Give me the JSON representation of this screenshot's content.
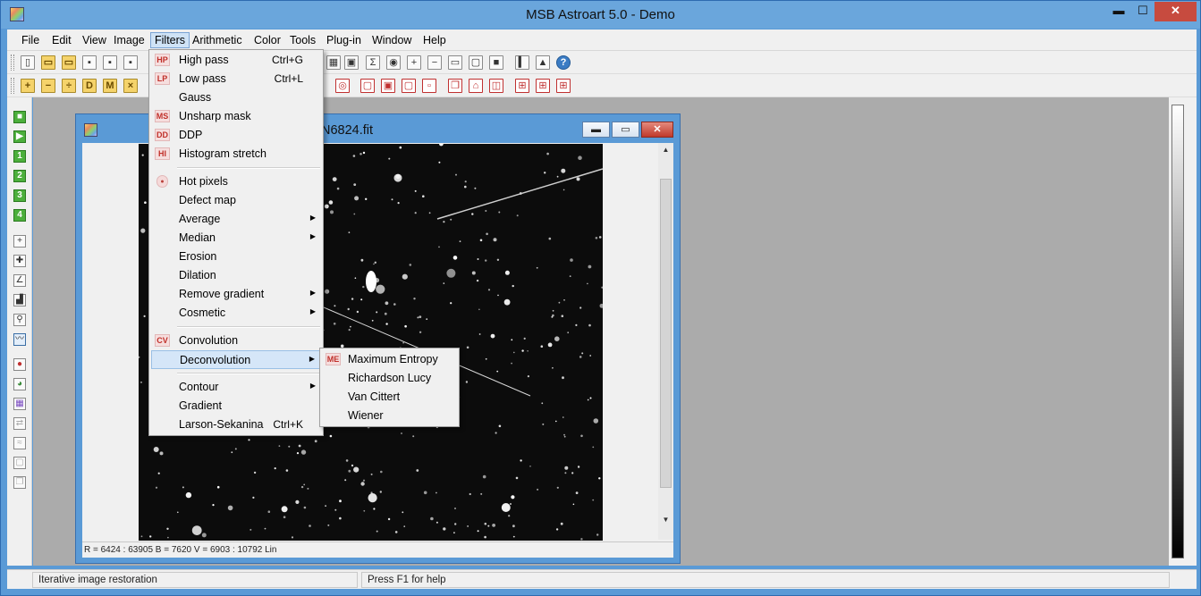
{
  "app": {
    "title": "MSB Astroart 5.0 - Demo",
    "controls": {
      "minimize": "▬",
      "maximize": "☐",
      "close": "✕"
    }
  },
  "menubar": [
    {
      "label": "File"
    },
    {
      "label": "Edit"
    },
    {
      "label": "View"
    },
    {
      "label": "Image"
    },
    {
      "label": "Filters"
    },
    {
      "label": "Arithmetic"
    },
    {
      "label": "Color"
    },
    {
      "label": "Tools"
    },
    {
      "label": "Plug-in"
    },
    {
      "label": "Window"
    },
    {
      "label": "Help"
    }
  ],
  "active_menu": "Filters",
  "toolbar1_icons": [
    "new-file-icon",
    "open-folder-icon",
    "open-recent-icon",
    "save-icon",
    "save-as-icon",
    "save-copy-icon",
    "bar-chart-icon",
    "sum-icon",
    "eye-icon",
    "zoom-in-icon",
    "zoom-out-icon",
    "monitor-icon",
    "window-icon",
    "fullscreen-icon",
    "align-icon",
    "columns-icon",
    "help-icon"
  ],
  "toolbar2_icons": {
    "yellow": [
      "+",
      "−",
      "÷",
      "D",
      "M",
      "×"
    ],
    "red": [
      "crop-icon",
      "select-icon",
      "frame-icon",
      "region-icon",
      "duplicate-icon",
      "rotate-icon",
      "mirror-icon",
      "grid-icon",
      "tile-icon",
      "mosaic-icon",
      "target-icon"
    ]
  },
  "left_tools": [
    {
      "name": "green-square-icon",
      "glyph": "■"
    },
    {
      "name": "green-play-icon",
      "glyph": "▶"
    },
    {
      "name": "green-1-icon",
      "glyph": "1"
    },
    {
      "name": "green-2-icon",
      "glyph": "2"
    },
    {
      "name": "green-3-icon",
      "glyph": "3"
    },
    {
      "name": "green-4-icon",
      "glyph": "4"
    },
    {
      "name": "crosshair-icon",
      "glyph": "+"
    },
    {
      "name": "marker-icon",
      "glyph": "✚"
    },
    {
      "name": "line-profile-icon",
      "glyph": "∠"
    },
    {
      "name": "chart-icon",
      "glyph": "▟"
    },
    {
      "name": "magnifier-icon",
      "glyph": "⚲"
    },
    {
      "name": "histogram-icon",
      "glyph": "〰"
    },
    {
      "name": "rgb-circles-icon",
      "glyph": "●"
    },
    {
      "name": "color-balance-icon",
      "glyph": "◕"
    },
    {
      "name": "palette-icon",
      "glyph": "▦"
    },
    {
      "name": "link-icon",
      "glyph": "⇄"
    },
    {
      "name": "wave-icon",
      "glyph": "≈"
    },
    {
      "name": "layer-icon",
      "glyph": "▢"
    },
    {
      "name": "stack-icon",
      "glyph": "❐"
    }
  ],
  "child_window": {
    "title": "N6824.fit",
    "controls": {
      "minimize": "▬",
      "maximize": "▭",
      "close": "✕"
    },
    "status": "R = 6424 : 63905    B = 7620    V = 6903 : 10792 Lin",
    "scroll_up": "▲",
    "scroll_down": "▼"
  },
  "filters_menu": {
    "items": [
      {
        "label": "High pass",
        "shortcut": "Ctrl+G",
        "icon": "HP",
        "submenu": false
      },
      {
        "label": "Low pass",
        "shortcut": "Ctrl+L",
        "icon": "LP",
        "submenu": false
      },
      {
        "label": "Gauss",
        "shortcut": "",
        "icon": "",
        "submenu": false
      },
      {
        "label": "Unsharp mask",
        "shortcut": "",
        "icon": "MS",
        "submenu": false
      },
      {
        "label": "DDP",
        "shortcut": "",
        "icon": "DD",
        "submenu": false
      },
      {
        "label": "Histogram stretch",
        "shortcut": "",
        "icon": "HI",
        "submenu": false
      },
      {
        "separator": true
      },
      {
        "label": "Hot pixels",
        "shortcut": "",
        "icon": "dot",
        "submenu": false
      },
      {
        "label": "Defect map",
        "shortcut": "",
        "icon": "",
        "submenu": false
      },
      {
        "label": "Average",
        "shortcut": "",
        "icon": "",
        "submenu": true
      },
      {
        "label": "Median",
        "shortcut": "",
        "icon": "",
        "submenu": true
      },
      {
        "label": "Erosion",
        "shortcut": "",
        "icon": "",
        "submenu": false
      },
      {
        "label": "Dilation",
        "shortcut": "",
        "icon": "",
        "submenu": false
      },
      {
        "label": "Remove gradient",
        "shortcut": "",
        "icon": "",
        "submenu": true
      },
      {
        "label": "Cosmetic",
        "shortcut": "",
        "icon": "",
        "submenu": true
      },
      {
        "separator": true
      },
      {
        "label": "Convolution",
        "shortcut": "",
        "icon": "CV",
        "submenu": false
      },
      {
        "label": "Deconvolution",
        "shortcut": "",
        "icon": "",
        "submenu": true,
        "highlighted": true
      },
      {
        "separator": true
      },
      {
        "label": "Contour",
        "shortcut": "",
        "icon": "",
        "submenu": true
      },
      {
        "label": "Gradient",
        "shortcut": "",
        "icon": "",
        "submenu": false
      },
      {
        "label": "Larson-Sekanina",
        "shortcut": "Ctrl+K",
        "icon": "",
        "submenu": false
      }
    ]
  },
  "deconvolution_submenu": {
    "items": [
      {
        "label": "Maximum Entropy",
        "icon": "ME"
      },
      {
        "label": "Richardson Lucy",
        "icon": ""
      },
      {
        "label": "Van Cittert",
        "icon": ""
      },
      {
        "label": "Wiener",
        "icon": ""
      }
    ]
  },
  "statusbar": {
    "left": "Iterative image restoration",
    "right": "Press F1 for help"
  }
}
